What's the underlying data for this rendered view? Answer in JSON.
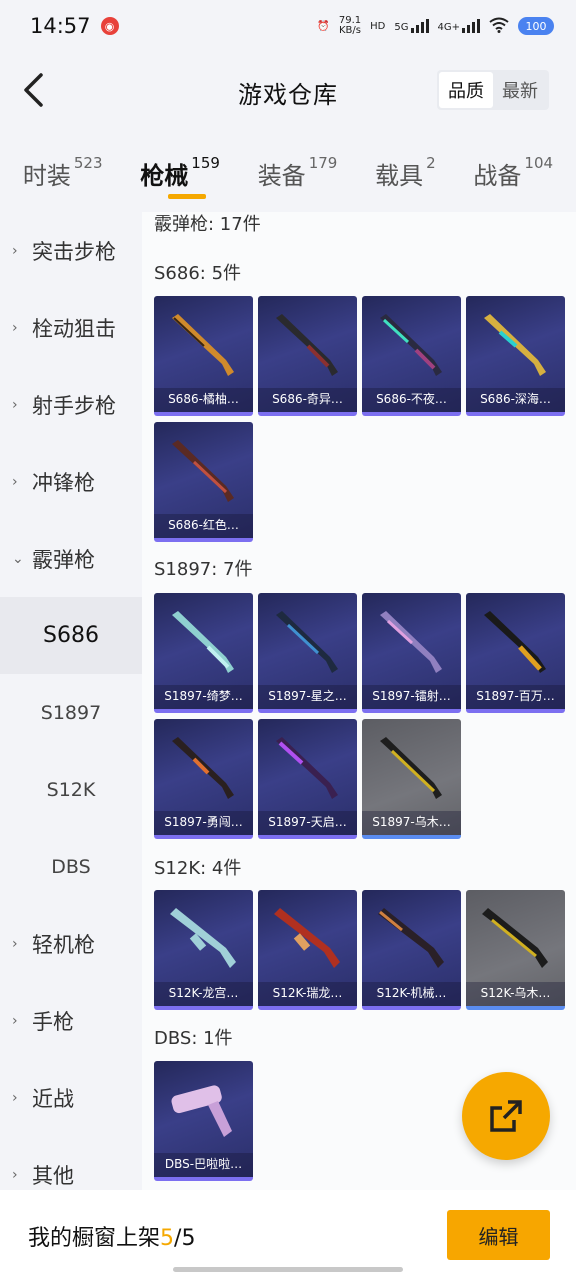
{
  "status": {
    "time": "14:57",
    "speed_value": "79.1",
    "speed_unit": "KB/s",
    "hd": "HD",
    "net1": "5G",
    "net2": "4G+",
    "battery": "100"
  },
  "header": {
    "title": "游戏仓库",
    "sort_quality": "品质",
    "sort_newest": "最新"
  },
  "tabs": [
    {
      "label": "时装",
      "count": "523"
    },
    {
      "label": "枪械",
      "count": "159"
    },
    {
      "label": "装备",
      "count": "179"
    },
    {
      "label": "载具",
      "count": "2"
    },
    {
      "label": "战备",
      "count": "104"
    }
  ],
  "sidebar": {
    "items": [
      {
        "label": "突击步枪",
        "chevron": "›"
      },
      {
        "label": "栓动狙击",
        "chevron": "›"
      },
      {
        "label": "射手步枪",
        "chevron": "›"
      },
      {
        "label": "冲锋枪",
        "chevron": "›"
      },
      {
        "label": "霰弹枪",
        "chevron": "⌄"
      },
      {
        "label": "S686"
      },
      {
        "label": "S1897"
      },
      {
        "label": "S12K"
      },
      {
        "label": "DBS"
      },
      {
        "label": "轻机枪",
        "chevron": "›"
      },
      {
        "label": "手枪",
        "chevron": "›"
      },
      {
        "label": "近战",
        "chevron": "›"
      },
      {
        "label": "其他",
        "chevron": "›"
      }
    ]
  },
  "main": {
    "category_header": "霰弹枪: 17件",
    "sections": [
      {
        "title": "S686: 5件",
        "items": [
          "S686-橘柚…",
          "S686-奇异…",
          "S686-不夜…",
          "S686-深海…",
          "S686-红色…"
        ]
      },
      {
        "title": "S1897: 7件",
        "items": [
          "S1897-绮梦…",
          "S1897-星之…",
          "S1897-镭射…",
          "S1897-百万…",
          "S1897-勇闯…",
          "S1897-天启…",
          "S1897-乌木…"
        ]
      },
      {
        "title": "S12K: 4件",
        "items": [
          "S12K-龙宫…",
          "S12K-瑞龙…",
          "S12K-机械…",
          "S12K-乌木…"
        ]
      },
      {
        "title": "DBS: 1件",
        "items": [
          "DBS-巴啦啦…"
        ]
      }
    ]
  },
  "bottom": {
    "label": "我的橱窗上架",
    "current": "5",
    "sep": "/",
    "total": "5",
    "edit": "编辑"
  },
  "colors": {
    "accent": "#f5a800",
    "card_blue": "#2e3270",
    "card_gray": "#6b6c72"
  }
}
